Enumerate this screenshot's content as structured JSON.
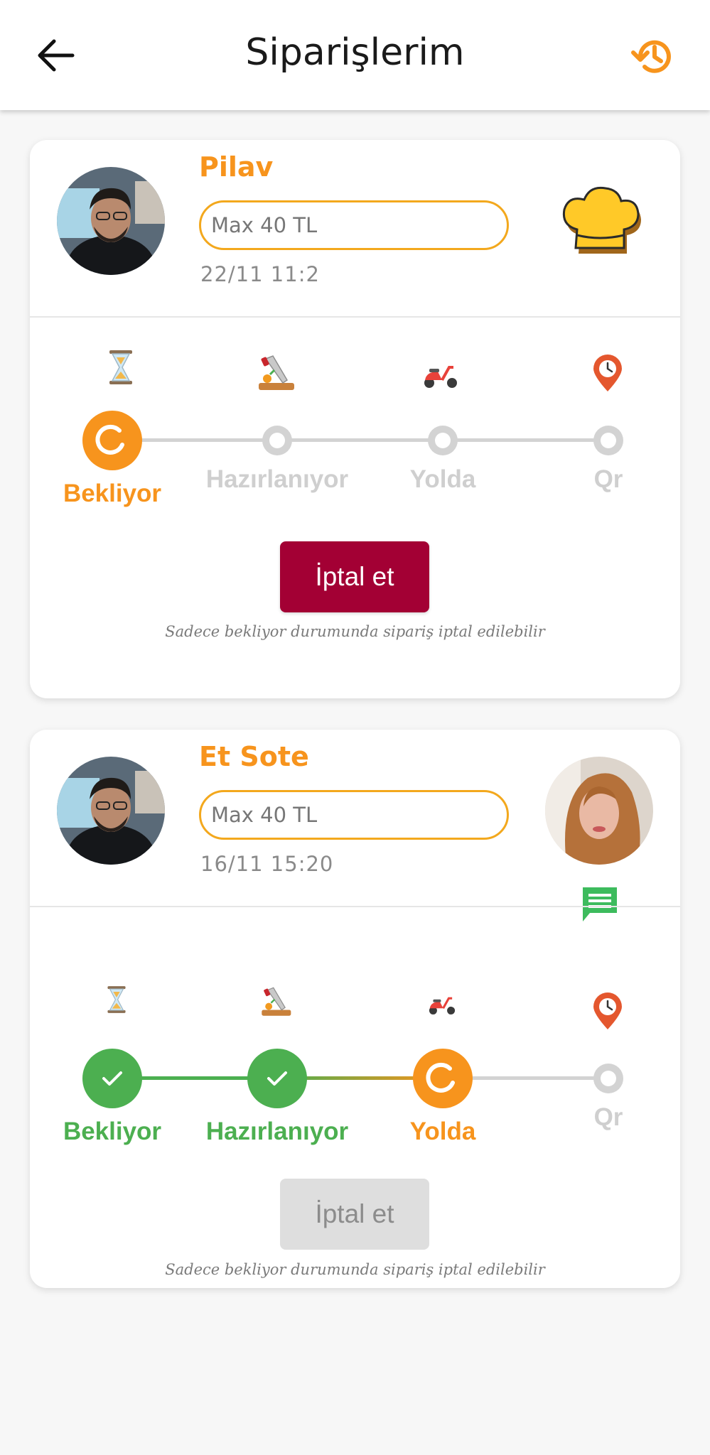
{
  "header": {
    "title": "Siparişlerim",
    "back_icon": "arrow-left-icon",
    "history_icon": "history-icon"
  },
  "colors": {
    "accent": "#f7941d",
    "success": "#4caf50",
    "cancel_active": "#a30034",
    "cancel_disabled": "#dedede",
    "inactive": "#d3d3d3"
  },
  "orders": [
    {
      "dish": "Pilav",
      "price": "Max 40 TL",
      "date": "22/11 11:2",
      "steps": [
        {
          "label": "Bekliyor",
          "icon": "hourglass-icon",
          "state": "active"
        },
        {
          "label": "Hazırlanıyor",
          "icon": "cutting-board-icon",
          "state": "pending"
        },
        {
          "label": "Yolda",
          "icon": "scooter-icon",
          "state": "pending"
        },
        {
          "label": "Qr",
          "icon": "location-clock-icon",
          "state": "pending"
        }
      ],
      "cancel_label": "İptal et",
      "cancel_enabled": true,
      "note": "Sadece bekliyor durumunda sipariş iptal edilebilir"
    },
    {
      "dish": "Et Sote",
      "price": "Max 40 TL",
      "date": "16/11 15:20",
      "steps": [
        {
          "label": "Bekliyor",
          "icon": "hourglass-icon",
          "state": "done"
        },
        {
          "label": "Hazırlanıyor",
          "icon": "cutting-board-icon",
          "state": "done"
        },
        {
          "label": "Yolda",
          "icon": "scooter-icon",
          "state": "active"
        },
        {
          "label": "Qr",
          "icon": "location-clock-icon",
          "state": "pending"
        }
      ],
      "cancel_label": "İptal et",
      "cancel_enabled": false,
      "note": "Sadece bekliyor durumunda sipariş iptal edilebilir"
    }
  ]
}
